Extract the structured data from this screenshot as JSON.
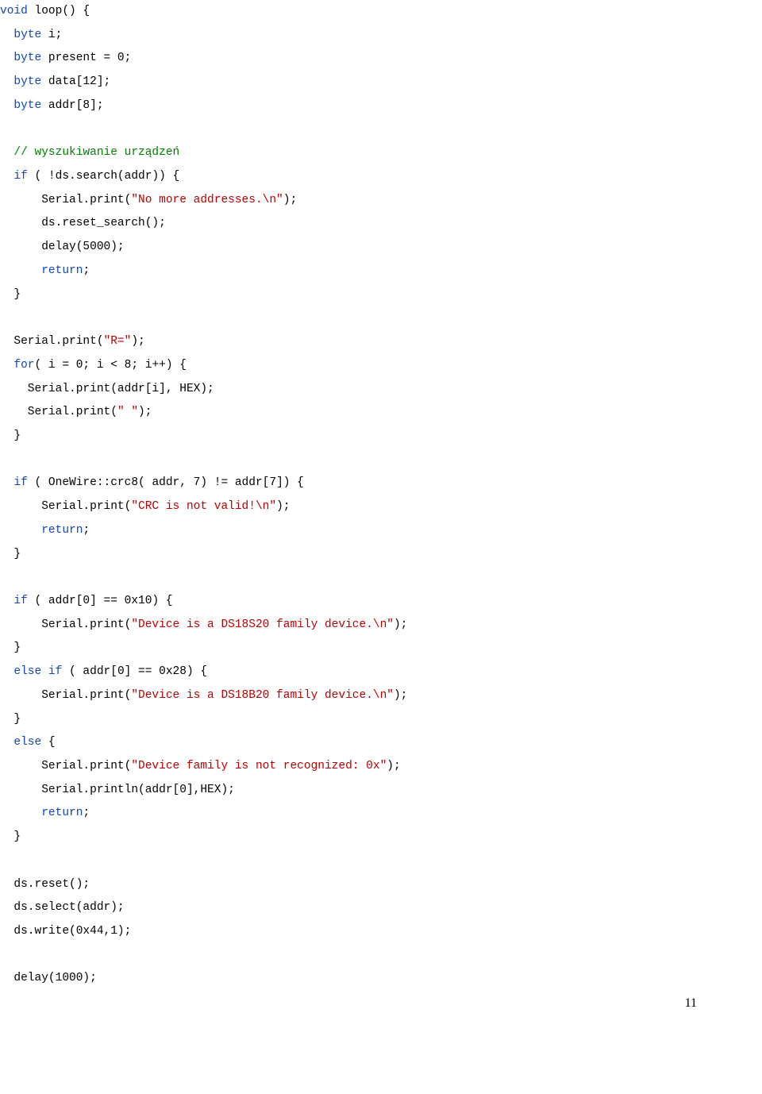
{
  "code_lines": [
    {
      "segments": [
        {
          "cls": "t-blue",
          "text": "void"
        },
        {
          "cls": "t-black",
          "text": " loop() {"
        }
      ]
    },
    {
      "segments": [
        {
          "cls": "t-black",
          "text": "  "
        },
        {
          "cls": "t-blue",
          "text": "byte"
        },
        {
          "cls": "t-black",
          "text": " i;"
        }
      ]
    },
    {
      "segments": [
        {
          "cls": "t-black",
          "text": "  "
        },
        {
          "cls": "t-blue",
          "text": "byte"
        },
        {
          "cls": "t-black",
          "text": " present = 0;"
        }
      ]
    },
    {
      "segments": [
        {
          "cls": "t-black",
          "text": "  "
        },
        {
          "cls": "t-blue",
          "text": "byte"
        },
        {
          "cls": "t-black",
          "text": " data[12];"
        }
      ]
    },
    {
      "segments": [
        {
          "cls": "t-black",
          "text": "  "
        },
        {
          "cls": "t-blue",
          "text": "byte"
        },
        {
          "cls": "t-black",
          "text": " addr[8];"
        }
      ]
    },
    {
      "segments": []
    },
    {
      "segments": [
        {
          "cls": "t-black",
          "text": "  "
        },
        {
          "cls": "t-green",
          "text": "// wyszukiwanie urządzeń"
        }
      ]
    },
    {
      "segments": [
        {
          "cls": "t-black",
          "text": "  "
        },
        {
          "cls": "t-blue",
          "text": "if"
        },
        {
          "cls": "t-black",
          "text": " ( !ds.search(addr)) {"
        }
      ]
    },
    {
      "segments": [
        {
          "cls": "t-black",
          "text": "      Serial.print("
        },
        {
          "cls": "t-red",
          "text": "\"No more addresses.\\n\""
        },
        {
          "cls": "t-black",
          "text": ");"
        }
      ]
    },
    {
      "segments": [
        {
          "cls": "t-black",
          "text": "      ds.reset_search();"
        }
      ]
    },
    {
      "segments": [
        {
          "cls": "t-black",
          "text": "      delay(5000);"
        }
      ]
    },
    {
      "segments": [
        {
          "cls": "t-black",
          "text": "      "
        },
        {
          "cls": "t-blue",
          "text": "return"
        },
        {
          "cls": "t-black",
          "text": ";"
        }
      ]
    },
    {
      "segments": [
        {
          "cls": "t-black",
          "text": "  }"
        }
      ]
    },
    {
      "segments": []
    },
    {
      "segments": [
        {
          "cls": "t-black",
          "text": "  Serial.print("
        },
        {
          "cls": "t-red",
          "text": "\"R=\""
        },
        {
          "cls": "t-black",
          "text": ");"
        }
      ]
    },
    {
      "segments": [
        {
          "cls": "t-black",
          "text": "  "
        },
        {
          "cls": "t-blue",
          "text": "for"
        },
        {
          "cls": "t-black",
          "text": "( i = 0; i < 8; i++) {"
        }
      ]
    },
    {
      "segments": [
        {
          "cls": "t-black",
          "text": "    Serial.print(addr[i], HEX);"
        }
      ]
    },
    {
      "segments": [
        {
          "cls": "t-black",
          "text": "    Serial.print("
        },
        {
          "cls": "t-red",
          "text": "\" \""
        },
        {
          "cls": "t-black",
          "text": ");"
        }
      ]
    },
    {
      "segments": [
        {
          "cls": "t-black",
          "text": "  }"
        }
      ]
    },
    {
      "segments": []
    },
    {
      "segments": [
        {
          "cls": "t-black",
          "text": "  "
        },
        {
          "cls": "t-blue",
          "text": "if"
        },
        {
          "cls": "t-black",
          "text": " ( OneWire::crc8( addr, 7) != addr[7]) {"
        }
      ]
    },
    {
      "segments": [
        {
          "cls": "t-black",
          "text": "      Serial.print("
        },
        {
          "cls": "t-red",
          "text": "\"CRC is not valid!\\n\""
        },
        {
          "cls": "t-black",
          "text": ");"
        }
      ]
    },
    {
      "segments": [
        {
          "cls": "t-black",
          "text": "      "
        },
        {
          "cls": "t-blue",
          "text": "return"
        },
        {
          "cls": "t-black",
          "text": ";"
        }
      ]
    },
    {
      "segments": [
        {
          "cls": "t-black",
          "text": "  }"
        }
      ]
    },
    {
      "segments": []
    },
    {
      "segments": [
        {
          "cls": "t-black",
          "text": "  "
        },
        {
          "cls": "t-blue",
          "text": "if"
        },
        {
          "cls": "t-black",
          "text": " ( addr[0] == 0x10) {"
        }
      ]
    },
    {
      "segments": [
        {
          "cls": "t-black",
          "text": "      Serial.print("
        },
        {
          "cls": "t-red",
          "text": "\"Device is a DS18S20 family device.\\n\""
        },
        {
          "cls": "t-black",
          "text": ");"
        }
      ]
    },
    {
      "segments": [
        {
          "cls": "t-black",
          "text": "  }"
        }
      ]
    },
    {
      "segments": [
        {
          "cls": "t-black",
          "text": "  "
        },
        {
          "cls": "t-blue",
          "text": "else if"
        },
        {
          "cls": "t-black",
          "text": " ( addr[0] == 0x28) {"
        }
      ]
    },
    {
      "segments": [
        {
          "cls": "t-black",
          "text": "      Serial.print("
        },
        {
          "cls": "t-red",
          "text": "\"Device is a DS18B20 family device.\\n\""
        },
        {
          "cls": "t-black",
          "text": ");"
        }
      ]
    },
    {
      "segments": [
        {
          "cls": "t-black",
          "text": "  }"
        }
      ]
    },
    {
      "segments": [
        {
          "cls": "t-black",
          "text": "  "
        },
        {
          "cls": "t-blue",
          "text": "else"
        },
        {
          "cls": "t-black",
          "text": " {"
        }
      ]
    },
    {
      "segments": [
        {
          "cls": "t-black",
          "text": "      Serial.print("
        },
        {
          "cls": "t-red",
          "text": "\"Device family is not recognized: 0x\""
        },
        {
          "cls": "t-black",
          "text": ");"
        }
      ]
    },
    {
      "segments": [
        {
          "cls": "t-black",
          "text": "      Serial.println(addr[0],HEX);"
        }
      ]
    },
    {
      "segments": [
        {
          "cls": "t-black",
          "text": "      "
        },
        {
          "cls": "t-blue",
          "text": "return"
        },
        {
          "cls": "t-black",
          "text": ";"
        }
      ]
    },
    {
      "segments": [
        {
          "cls": "t-black",
          "text": "  }"
        }
      ]
    },
    {
      "segments": []
    },
    {
      "segments": [
        {
          "cls": "t-black",
          "text": "  ds.reset();"
        }
      ]
    },
    {
      "segments": [
        {
          "cls": "t-black",
          "text": "  ds.select(addr);"
        }
      ]
    },
    {
      "segments": [
        {
          "cls": "t-black",
          "text": "  ds.write(0x44,1);"
        }
      ]
    },
    {
      "segments": []
    },
    {
      "segments": [
        {
          "cls": "t-black",
          "text": "  delay(1000);"
        }
      ]
    }
  ],
  "page_number": "11"
}
